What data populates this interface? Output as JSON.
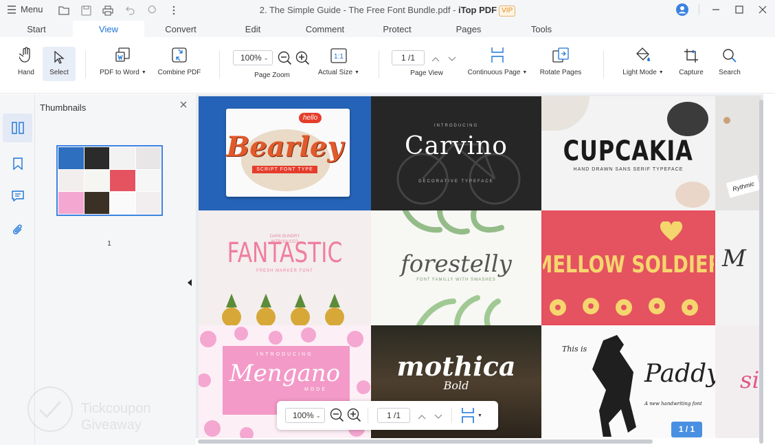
{
  "titlebar": {
    "menu_label": "Menu",
    "doc_title": "2. The Simple Guide - The Free Font Bundle.pdf - ",
    "brand": "iTop PDF",
    "vip": "VIP"
  },
  "tabs": [
    "Start",
    "View",
    "Convert",
    "Edit",
    "Comment",
    "Protect",
    "Pages",
    "Tools"
  ],
  "active_tab": "View",
  "ribbon": {
    "hand": "Hand",
    "select": "Select",
    "pdf_to_word": "PDF to Word",
    "combine_pdf": "Combine PDF",
    "zoom_value": "100%",
    "page_zoom": "Page Zoom",
    "actual_size": "Actual Size",
    "page_input": "1 /1",
    "page_view": "Page View",
    "continuous_page": "Continuous Page",
    "rotate_pages": "Rotate Pages",
    "light_mode": "Light Mode",
    "capture": "Capture",
    "search": "Search"
  },
  "thumbnails": {
    "title": "Thumbnails",
    "page_number": "1"
  },
  "watermark": {
    "line1": "Tickcoupon",
    "line2": "Giveaway"
  },
  "document": {
    "fonts": [
      {
        "name": "Bearley",
        "sub": "SCRIPT FONT TYPE"
      },
      {
        "name": "Carvino",
        "sub": "DECORATIVE TYPEFACE"
      },
      {
        "name": "CUPCAKIA",
        "sub": "HAND DRAWN SANS SERIF TYPEFACE"
      },
      {
        "name": "Rythmic",
        "sub": ""
      },
      {
        "name": "FANTASTIC",
        "sub": "FRESH MARKER FONT"
      },
      {
        "name": "forestelly",
        "sub": "FONT FAMILLY WITH SWASHES"
      },
      {
        "name": "MELLOW SOLDIER",
        "sub": ""
      },
      {
        "name": "M",
        "sub": ""
      },
      {
        "name": "Mengano",
        "sub": "MODE"
      },
      {
        "name": "mothica",
        "sub": "Bold"
      },
      {
        "name": "Paddy",
        "sub": "A new handwriting font"
      },
      {
        "name": "si",
        "sub": ""
      }
    ],
    "fantastic_top": "DARK BUNDRY INTRODUCED",
    "mengano_top": "INTRODUCING",
    "paddy_pre": "This is",
    "carvino_top": "INTRODUCING",
    "bearley_hello": "hello"
  },
  "floatbar": {
    "zoom_value": "100%",
    "page_input": "1 /1"
  },
  "page_badge": "1 / 1",
  "colors": {
    "accent": "#1a73d8",
    "selection": "#3b82e0",
    "badge": "#4a90e2"
  }
}
